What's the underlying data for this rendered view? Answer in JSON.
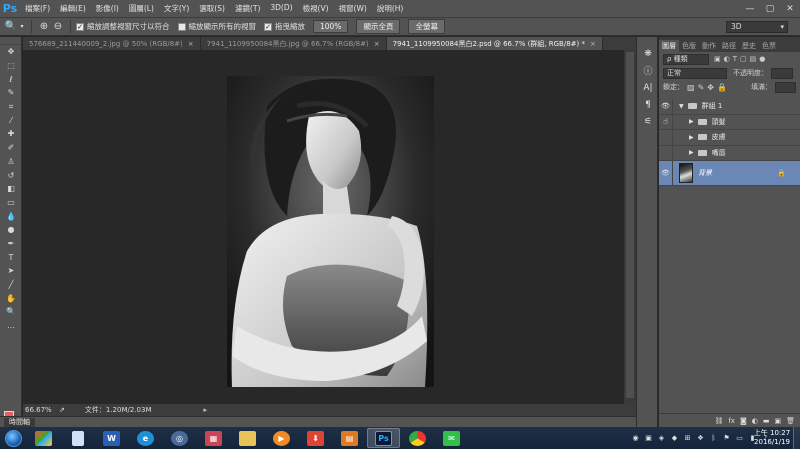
{
  "app": {
    "logo": "Ps"
  },
  "menu": [
    "檔案(F)",
    "編輯(E)",
    "影像(I)",
    "圖層(L)",
    "文字(Y)",
    "選取(S)",
    "濾鏡(T)",
    "3D(D)",
    "檢視(V)",
    "視窗(W)",
    "說明(H)"
  ],
  "window_controls": [
    "—",
    "▢",
    "✕"
  ],
  "options": {
    "resize_windows": "縮放調整視窗尺寸以符合",
    "zoom_all": "縮放顯示所有的視窗",
    "scrubby_zoom": "拖曳縮放",
    "zoom_value": "100%",
    "fit_screen": "顯示全頁",
    "fill_screen": "全螢幕",
    "workspace": "3D"
  },
  "tabs": [
    {
      "label": "576689_211440009_2.jpg @ 50% (RGB/8#)",
      "close": "×",
      "active": false
    },
    {
      "label": "7941_1109950084黑白.jpg @ 66.7% (RGB/8#)",
      "close": "×",
      "active": false
    },
    {
      "label": "7941_1109950084黑白2.psd @ 66.7% (群組, RGB/8#) *",
      "close": "×",
      "active": true
    }
  ],
  "status": {
    "zoom": "66.67%",
    "doc": "文件：1.20M/2.03M"
  },
  "timeline_tab": "時間軸",
  "panel": {
    "tabs": [
      "圖層",
      "色版",
      "動作",
      "路徑",
      "歷史",
      "色票"
    ],
    "filter_kind": "種類",
    "blend_mode": "正常",
    "opacity_label": "不透明度：",
    "lock_label": "鎖定：",
    "fill_label": "填滿："
  },
  "layers": [
    {
      "name": "群組 1",
      "kind": "group",
      "visible": true
    },
    {
      "name": "頭髮",
      "kind": "group-child",
      "visible": true
    },
    {
      "name": "皮膚",
      "kind": "group-child",
      "visible": false
    },
    {
      "name": "嘴唇",
      "kind": "group-child",
      "visible": false
    },
    {
      "name": "背景",
      "kind": "background",
      "visible": true
    }
  ],
  "clock": {
    "time": "上午 10:27",
    "date": "2016/1/19"
  },
  "colors": {
    "accent": "#6b87b6",
    "foreground": "#e85e5e",
    "background": "#ffffff",
    "ps_blue": "#31a8ff"
  }
}
